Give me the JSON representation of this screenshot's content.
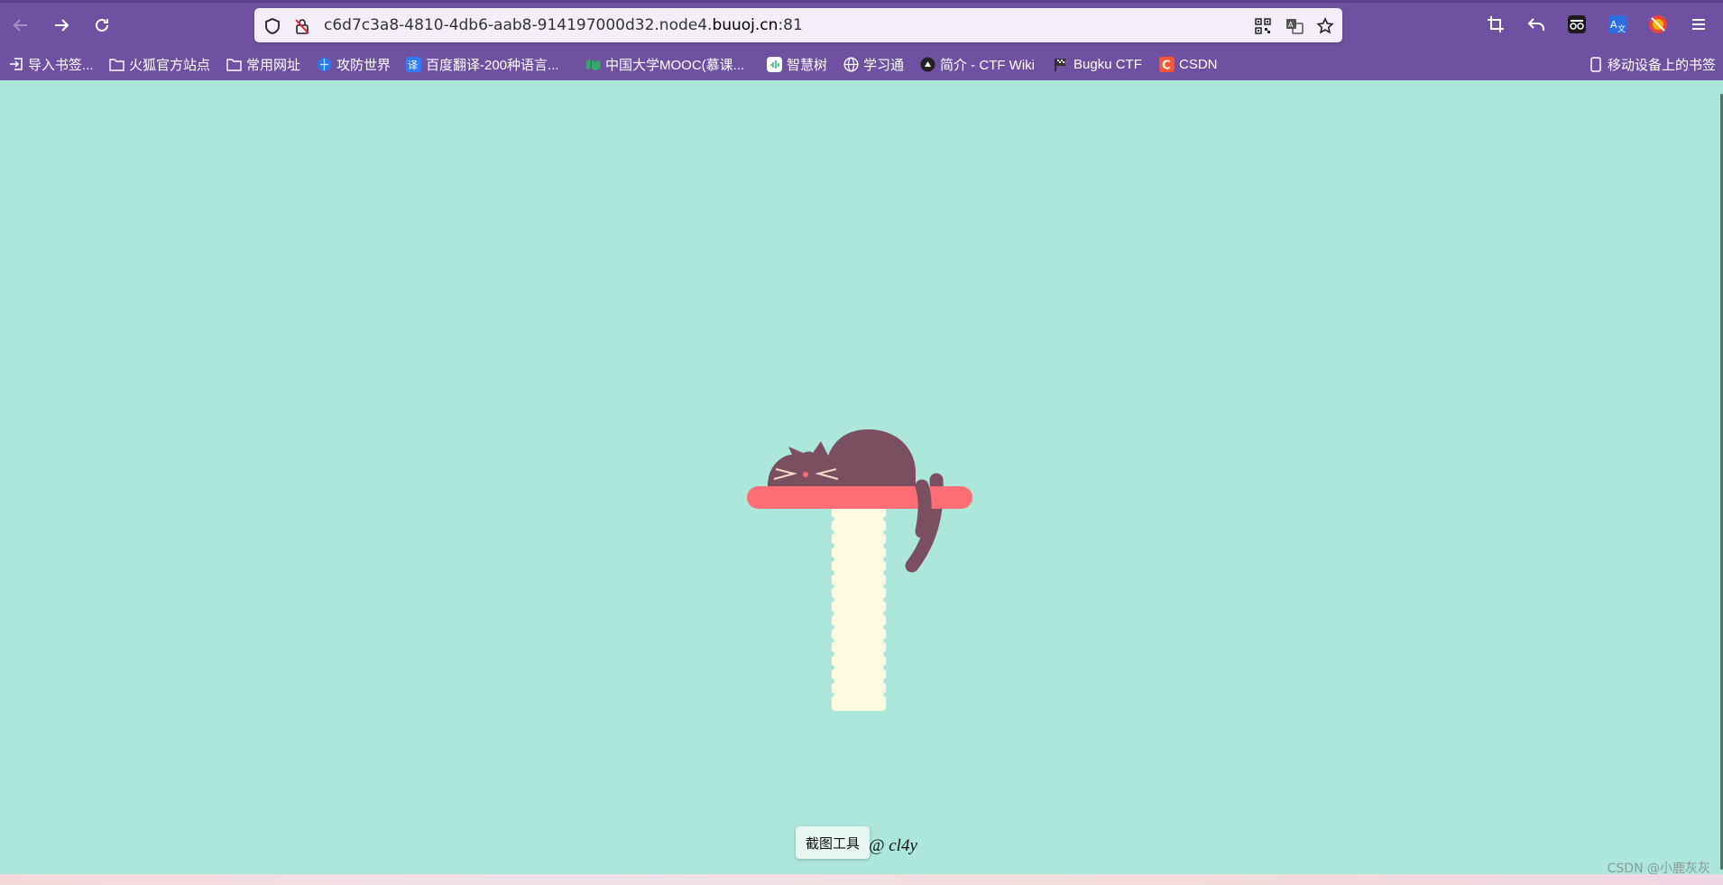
{
  "browser": {
    "url_host_prefix": "c6d7c3a8-4810-4db6-aab8-914197000d32.node4.",
    "url_host_main": "buuoj.cn",
    "url_port": ":81",
    "mobile_bookmarks": "移动设备上的书签"
  },
  "bookmarks": [
    {
      "label": "导入书签...",
      "icon": "import-icon"
    },
    {
      "label": "火狐官方站点",
      "icon": "folder-icon"
    },
    {
      "label": "常用网址",
      "icon": "folder-icon"
    },
    {
      "label": "攻防世界",
      "icon": "globe-blue-icon"
    },
    {
      "label": "百度翻译-200种语言...",
      "icon": "translate-icon"
    },
    {
      "label": "中国大学MOOC(慕课...",
      "icon": "mooc-icon"
    },
    {
      "label": "智慧树",
      "icon": "zhihuishu-icon"
    },
    {
      "label": "学习通",
      "icon": "globe-icon"
    },
    {
      "label": "简介 - CTF Wiki",
      "icon": "ctfwiki-icon"
    },
    {
      "label": "Bugku CTF",
      "icon": "flag-icon"
    },
    {
      "label": "CSDN",
      "icon": "csdn-icon"
    }
  ],
  "page": {
    "screenshot_tool": "截图工具",
    "author": "@ cl4y",
    "watermark": "CSDN @小鹿灰灰"
  },
  "colors": {
    "background": "#ade6db",
    "chrome": "#7051a1",
    "cat": "#7a4f5f",
    "shelf": "#ff6e74",
    "post": "#fff9e0"
  }
}
